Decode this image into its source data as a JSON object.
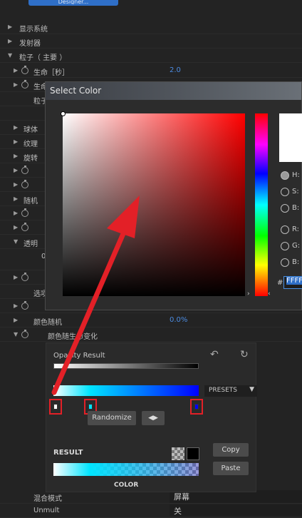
{
  "top_button": {
    "label": "Designer..."
  },
  "rows": {
    "display_system": "显示系统",
    "emitter": "发射器",
    "particles": "粒子（ 主要 ）",
    "life": "生命［秒］",
    "life_value": "2.0",
    "life_random": "生命",
    "particle_type": "粒子",
    "sphere": "球体",
    "texture": "纹理",
    "rotation": "旋转",
    "row_a": "",
    "row_b": "",
    "random": "随机",
    "row_c": "",
    "row_d": "",
    "transparency": "透明",
    "row_e": "0",
    "row_f": "",
    "select": "选项",
    "row_g": "",
    "color_random": "颜色随机",
    "color_random_value": "0.0%",
    "color_over_life": "颜色随生命变化",
    "blend_mode": "混合模式",
    "blend_mode_value": "屏幕",
    "unmult": "Unmult",
    "unmult_value": "关"
  },
  "color_dialog": {
    "title": "Select Color",
    "h_label": "H:",
    "s_label": "S:",
    "b_label": "B:",
    "r_label": "R:",
    "g_label": "G:",
    "bl_label": "B:",
    "hash": "#",
    "hex_value": "FFFF",
    "preview_color": "#ffffff"
  },
  "gradient_panel": {
    "opacity_title": "Opacity Result",
    "presets_label": "PRESETS",
    "randomize_label": "Randomize",
    "result_label": "RESULT",
    "copy_label": "Copy",
    "paste_label": "Paste",
    "color_label": "COLOR",
    "stops": [
      "#ffffff",
      "#00e5ff",
      "#0000ff"
    ]
  },
  "annotation": {
    "color": "#e32027"
  }
}
